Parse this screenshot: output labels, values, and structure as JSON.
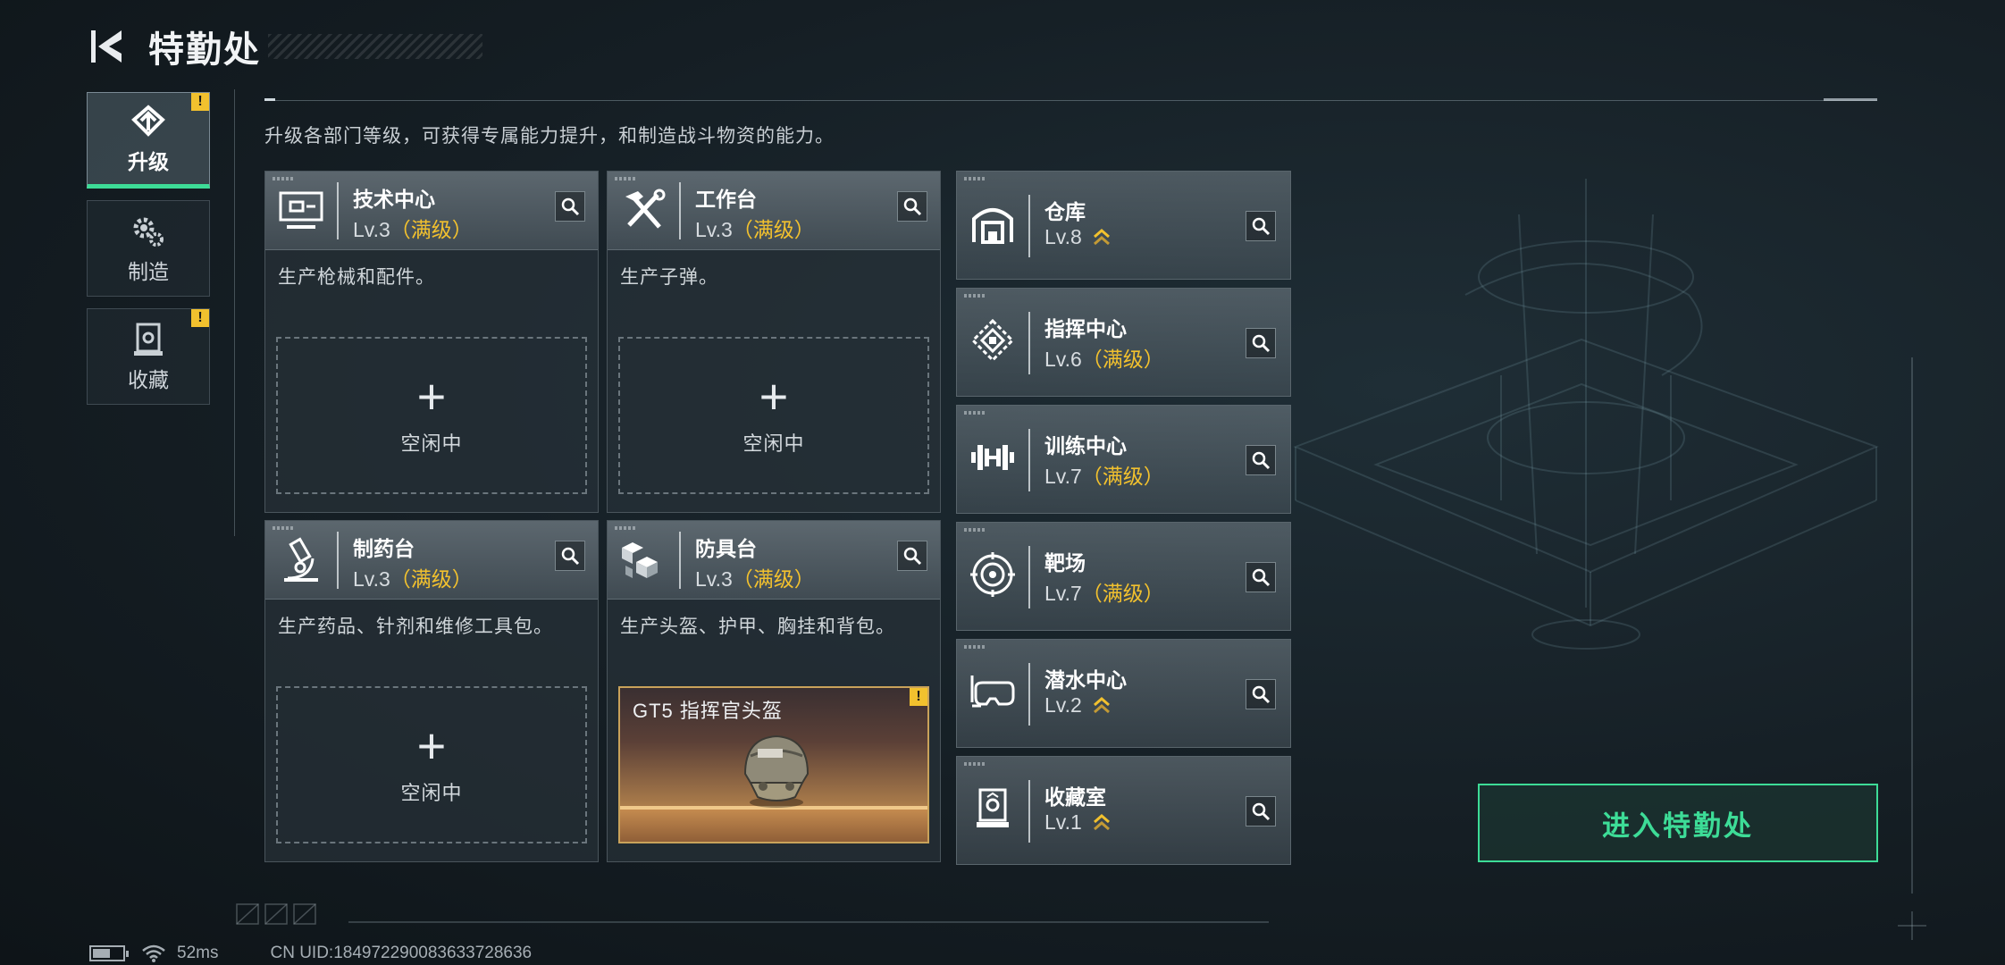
{
  "header": {
    "title": "特勤处",
    "back_icon": "back-arrow-icon"
  },
  "sidenav": [
    {
      "label": "升级",
      "icon": "upgrade-icon",
      "active": true,
      "alert": true
    },
    {
      "label": "制造",
      "icon": "gears-icon",
      "active": false,
      "alert": false
    },
    {
      "label": "收藏",
      "icon": "collection-icon",
      "active": false,
      "alert": true
    }
  ],
  "alert_symbol": "!",
  "description": "升级各部门等级，可获得专属能力提升，和制造战斗物资的能力。",
  "departments": [
    {
      "name": "技术中心",
      "level": "Lv.3",
      "max": "（满级）",
      "desc": "生产枪械和配件。",
      "icon": "computer-icon",
      "slot": {
        "plus": "+",
        "status": "空闲中"
      }
    },
    {
      "name": "工作台",
      "level": "Lv.3",
      "max": "（满级）",
      "desc": "生产子弹。",
      "icon": "tools-icon",
      "slot": {
        "plus": "+",
        "status": "空闲中"
      }
    },
    {
      "name": "制药台",
      "level": "Lv.3",
      "max": "（满级）",
      "desc": "生产药品、针剂和维修工具包。",
      "icon": "microscope-icon",
      "slot": {
        "plus": "+",
        "status": "空闲中"
      }
    },
    {
      "name": "防具台",
      "level": "Lv.3",
      "max": "（满级）",
      "desc": "生产头盔、护甲、胸挂和背包。",
      "icon": "armor-blocks-icon",
      "crafting": {
        "item": "GT5 指挥官头盔",
        "alert": true
      }
    }
  ],
  "facilities": [
    {
      "name": "仓库",
      "level": "Lv.8",
      "max": "",
      "upgradable": true,
      "icon": "warehouse-icon"
    },
    {
      "name": "指挥中心",
      "level": "Lv.6",
      "max": "（满级）",
      "upgradable": false,
      "icon": "command-center-icon"
    },
    {
      "name": "训练中心",
      "level": "Lv.7",
      "max": "（满级）",
      "upgradable": false,
      "icon": "dumbbell-icon"
    },
    {
      "name": "靶场",
      "level": "Lv.7",
      "max": "（满级）",
      "upgradable": false,
      "icon": "target-icon"
    },
    {
      "name": "潜水中心",
      "level": "Lv.2",
      "max": "",
      "upgradable": true,
      "icon": "diving-mask-icon"
    },
    {
      "name": "收藏室",
      "level": "Lv.1",
      "max": "",
      "upgradable": true,
      "icon": "collection-room-icon"
    }
  ],
  "enter_button": "进入特勤处",
  "status": {
    "battery_level": 0.6,
    "ping": "52ms",
    "uid": "CN UID:18497229008363372863​6"
  },
  "colors": {
    "accent_green": "#3ddc97",
    "max_gold": "#f2c12e",
    "alert_yellow": "#f2c12e"
  }
}
